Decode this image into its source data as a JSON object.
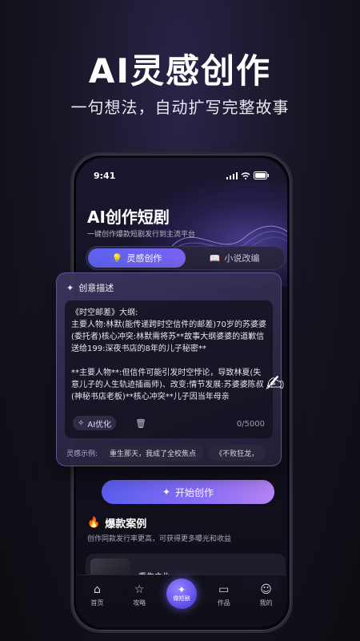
{
  "hero": {
    "title": "AI灵感创作",
    "subtitle": "一句想法，自动扩写完整故事"
  },
  "status_bar": {
    "time": "9:41"
  },
  "app": {
    "title": "AI创作短剧",
    "subtitle": "一键创作爆款短剧发行到主流平台"
  },
  "tabs": [
    {
      "label": "灵感创作",
      "icon": "bulb-icon",
      "active": true
    },
    {
      "label": "小说改编",
      "icon": "book-icon",
      "active": false
    }
  ],
  "idea_card": {
    "title": "创意描述",
    "text": "《时空邮差》大纲:\n主要人物:林默(能传递跨时空信件的邮差)70岁的苏婆婆(委托者)核心冲突:林默需将苏**故事大纲婆婆的道歉信送给199:深夜书店的8年的儿子秘密**\n\n**主要人物**:但信件可能引发时空悖论，导致林夏(失意儿子的人生轨迹插画师)、改变:情节发展:苏婆婆陈叔(神秘书店老板)**核心冲突**儿子因当年母亲",
    "ai_optimize": "AI优化",
    "counter": "0/5000"
  },
  "examples": {
    "label": "灵感示例:",
    "chips": [
      "重生那天，我成了全校焦点",
      "《不败狂龙，"
    ]
  },
  "start_button": "开始创作",
  "hot": {
    "title": "爆款案例",
    "subtitle": "创作同款发行率更高，可获得更多曝光和收益",
    "case_title": "重生之仇"
  },
  "tabbar": [
    {
      "label": "首页",
      "icon": "home-icon"
    },
    {
      "label": "攻略",
      "icon": "guide-icon"
    },
    {
      "label": "做短剧",
      "icon": "sparkle-icon"
    },
    {
      "label": "作品",
      "icon": "folder-icon"
    },
    {
      "label": "我的",
      "icon": "user-icon"
    }
  ],
  "colors": {
    "accent": "#6b63f2",
    "background": "#15131f"
  }
}
